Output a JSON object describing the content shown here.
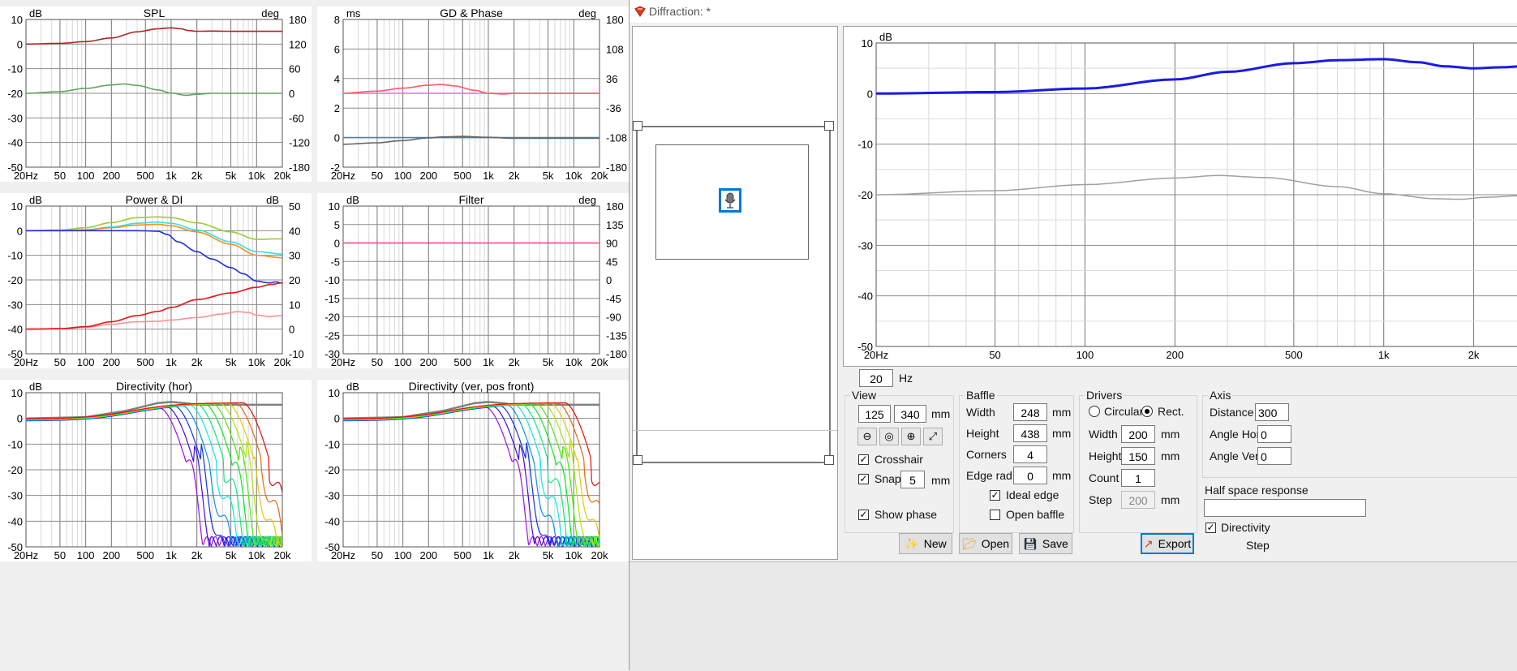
{
  "window": {
    "title": "Diffraction: *",
    "accent": "#0078d7"
  },
  "left_charts": [
    {
      "name": "spl",
      "title": "SPL",
      "left_unit": "dB",
      "right_unit": "deg",
      "y_ticks": [
        "10",
        "0",
        "-10",
        "-20",
        "-30",
        "-40",
        "-50"
      ],
      "r_ticks": [
        "180",
        "120",
        "60",
        "0",
        "-60",
        "-120",
        "-180"
      ],
      "x_ticks": [
        "20Hz",
        "50",
        "100",
        "200",
        "500",
        "1k",
        "2k",
        "5k",
        "10k",
        "20k"
      ],
      "chart_data": {
        "type": "line",
        "x_log": true,
        "xlim": [
          20,
          20000
        ],
        "ylim": [
          -50,
          10
        ],
        "grid": true,
        "series": [
          {
            "color": "#b22222",
            "x": [
              20,
              50,
              100,
              200,
              400,
              700,
              1000,
              1300,
              1600,
              2000,
              3000,
              5000,
              10000,
              20000
            ],
            "y": [
              0,
              0.3,
              1,
              2.5,
              5,
              6.2,
              6.6,
              6.2,
              5.5,
              5.2,
              5.3,
              5.2,
              5.2,
              5.2
            ]
          },
          {
            "color": "#5fa55f",
            "x": [
              20,
              50,
              100,
              200,
              280,
              400,
              700,
              1000,
              1500,
              2000,
              3000,
              5000,
              10000,
              20000
            ],
            "y": [
              -20,
              -19.3,
              -18,
              -16.6,
              -16.2,
              -16.8,
              -18.6,
              -19.9,
              -20.8,
              -20.4,
              -20,
              -20,
              -20,
              -20
            ]
          }
        ]
      }
    },
    {
      "name": "gd-phase",
      "title": "GD & Phase",
      "left_unit": "ms",
      "right_unit": "deg",
      "y_ticks": [
        "8",
        "6",
        "4",
        "2",
        "0",
        "-2"
      ],
      "r_ticks": [
        "180",
        "108",
        "36",
        "-36",
        "-108",
        "-180"
      ],
      "x_ticks": [
        "20Hz",
        "50",
        "100",
        "200",
        "500",
        "1k",
        "2k",
        "5k",
        "10k",
        "20k"
      ],
      "chart_data": {
        "type": "line",
        "x_log": true,
        "xlim": [
          20,
          20000
        ],
        "ylim": [
          -2,
          8
        ],
        "grid": true,
        "series": [
          {
            "color": "#ee66ee",
            "x": [
              20,
              20000
            ],
            "y": [
              3,
              3
            ]
          },
          {
            "color": "#ff5a5a",
            "x": [
              20,
              50,
              100,
              200,
              280,
              400,
              700,
              1000,
              1500,
              2000,
              5000,
              20000
            ],
            "y": [
              3,
              3.15,
              3.35,
              3.55,
              3.6,
              3.5,
              3.2,
              3.0,
              2.95,
              3,
              3,
              3
            ]
          },
          {
            "color": "#4682b4",
            "x": [
              20,
              20000
            ],
            "y": [
              0,
              0
            ]
          },
          {
            "color": "#666666",
            "x": [
              20,
              50,
              100,
              200,
              300,
              500,
              1000,
              2000,
              20000
            ],
            "y": [
              -0.45,
              -0.35,
              -0.2,
              -0.02,
              0.05,
              0.08,
              0.02,
              -0.05,
              -0.05
            ]
          }
        ]
      }
    },
    {
      "name": "power-di",
      "title": "Power & DI",
      "left_unit": "dB",
      "right_unit": "dB",
      "y_ticks": [
        "10",
        "0",
        "-10",
        "-20",
        "-30",
        "-40",
        "-50"
      ],
      "r_ticks": [
        "50",
        "40",
        "30",
        "20",
        "10",
        "0",
        "-10"
      ],
      "x_ticks": [
        "20Hz",
        "50",
        "100",
        "200",
        "500",
        "1k",
        "2k",
        "5k",
        "10k",
        "20k"
      ],
      "chart_data": {
        "type": "line",
        "x_log": true,
        "xlim": [
          20,
          20000
        ],
        "ylim": [
          -50,
          10
        ],
        "grid": true,
        "series": [
          {
            "color": "#9acd32",
            "x": [
              20,
              50,
              100,
              200,
              400,
              700,
              1000,
              2000,
              5000,
              10000,
              20000
            ],
            "y": [
              0,
              0.3,
              1.2,
              3.3,
              5.3,
              5.6,
              5.3,
              3.2,
              -0.5,
              -3.5,
              -3.3
            ]
          },
          {
            "color": "#33e0e8",
            "x": [
              20,
              50,
              100,
              200,
              400,
              700,
              1000,
              2000,
              5000,
              10000,
              20000
            ],
            "y": [
              0,
              0,
              0.4,
              1.5,
              3,
              3.5,
              3,
              0.3,
              -4.5,
              -8.5,
              -9.5
            ]
          },
          {
            "color": "#ff8c1a",
            "x": [
              20,
              50,
              100,
              200,
              400,
              700,
              1000,
              2000,
              5000,
              10000,
              20000
            ],
            "y": [
              0,
              0,
              0.3,
              1.2,
              2.3,
              2.6,
              2,
              -0.5,
              -5.5,
              -10,
              -11
            ]
          },
          {
            "color": "#1e2ee0",
            "x": [
              20,
              50,
              100,
              200,
              400,
              700,
              900,
              1200,
              2000,
              3000,
              5000,
              7000,
              10000,
              14000,
              17000,
              20000
            ],
            "y": [
              0,
              0,
              0,
              0,
              0,
              -0.2,
              -1.5,
              -4.5,
              -8.5,
              -11.5,
              -15,
              -17.5,
              -20.5,
              -21.2,
              -20.8,
              -21.3
            ]
          },
          {
            "color": "#ff9090",
            "x": [
              20,
              50,
              100,
              200,
              400,
              700,
              1000,
              2000,
              4000,
              6000,
              8000,
              10000,
              14000,
              20000
            ],
            "y": [
              -40,
              -39.8,
              -39.2,
              -38,
              -37,
              -36.8,
              -36.3,
              -35.3,
              -33.8,
              -32.9,
              -33.2,
              -34.3,
              -34.8,
              -34.5
            ]
          },
          {
            "color": "#ee1111",
            "x": [
              20,
              50,
              100,
              200,
              400,
              700,
              1000,
              2000,
              5000,
              10000,
              15000,
              20000
            ],
            "y": [
              -40,
              -39.8,
              -39,
              -37,
              -34.5,
              -32.8,
              -31.2,
              -28,
              -25.3,
              -23,
              -21.8,
              -21.2
            ]
          }
        ]
      }
    },
    {
      "name": "filter",
      "title": "Filter",
      "left_unit": "dB",
      "right_unit": "deg",
      "y_ticks": [
        "10",
        "5",
        "0",
        "-5",
        "-10",
        "-15",
        "-20",
        "-25",
        "-30"
      ],
      "r_ticks": [
        "180",
        "135",
        "90",
        "45",
        "0",
        "-45",
        "-90",
        "-135",
        "-180"
      ],
      "x_ticks": [
        "20Hz",
        "50",
        "100",
        "200",
        "500",
        "1k",
        "2k",
        "5k",
        "10k",
        "20k"
      ],
      "chart_data": {
        "type": "line",
        "x_log": true,
        "xlim": [
          20,
          20000
        ],
        "ylim": [
          -30,
          10
        ],
        "grid": true,
        "series": [
          {
            "color": "#ff3b8a",
            "x": [
              20,
              20000
            ],
            "y": [
              0,
              0
            ]
          }
        ]
      }
    },
    {
      "name": "directivity-hor",
      "title": "Directivity (hor)",
      "left_unit": "dB",
      "right_unit": "",
      "y_ticks": [
        "10",
        "0",
        "-10",
        "-20",
        "-30",
        "-40",
        "-50"
      ],
      "r_ticks": [],
      "x_ticks": [
        "20Hz",
        "50",
        "100",
        "200",
        "500",
        "1k",
        "2k",
        "5k",
        "10k",
        "20k"
      ],
      "chart_data": {
        "type": "line",
        "x_log": true,
        "xlim": [
          20,
          20000
        ],
        "ylim": [
          -50,
          10
        ],
        "grid": true,
        "family": "polar-fan",
        "fc_start": 1500,
        "fc_end": 14000,
        "count": 12
      }
    },
    {
      "name": "directivity-ver",
      "title": "Directivity (ver, pos front)",
      "left_unit": "dB",
      "right_unit": "",
      "y_ticks": [
        "10",
        "0",
        "-10",
        "-20",
        "-30",
        "-40",
        "-50"
      ],
      "r_ticks": [],
      "x_ticks": [
        "20Hz",
        "50",
        "100",
        "200",
        "500",
        "1k",
        "2k",
        "5k",
        "10k",
        "20k"
      ],
      "chart_data": {
        "type": "line",
        "x_log": true,
        "xlim": [
          20,
          20000
        ],
        "ylim": [
          -50,
          10
        ],
        "grid": true,
        "family": "polar-fan",
        "fc_start": 1900,
        "fc_end": 16000,
        "count": 12
      }
    }
  ],
  "main_chart": {
    "left_unit": "dB",
    "y_ticks": [
      "10",
      "0",
      "-10",
      "-20",
      "-30",
      "-40",
      "-50"
    ],
    "x_ticks": [
      "20Hz",
      "50",
      "100",
      "200",
      "500",
      "1k",
      "2k"
    ],
    "chart_data": {
      "type": "line",
      "x_log": true,
      "xlim": [
        20,
        2900
      ],
      "ylim": [
        -50,
        10
      ],
      "grid": true,
      "series": [
        {
          "color": "#1a1ae6",
          "width": 3,
          "x": [
            20,
            50,
            100,
            200,
            300,
            500,
            700,
            1000,
            1300,
            1600,
            2000,
            2500,
            2900
          ],
          "y": [
            0,
            0.3,
            1,
            2.8,
            4.3,
            6,
            6.6,
            6.8,
            6.2,
            5.4,
            5.0,
            5.2,
            5.4
          ]
        },
        {
          "color": "#a0a0a0",
          "width": 1.5,
          "x": [
            20,
            50,
            100,
            200,
            280,
            400,
            700,
            1000,
            1500,
            1800,
            2200,
            2900
          ],
          "y": [
            -20,
            -19.2,
            -18,
            -16.7,
            -16.2,
            -16.6,
            -18.4,
            -19.8,
            -20.8,
            -20.9,
            -20.5,
            -20.2
          ]
        }
      ]
    }
  },
  "freq": {
    "value": "20",
    "unit": "Hz"
  },
  "view": {
    "title": "View",
    "w": "125",
    "h": "340",
    "unit": "mm",
    "crosshair": "Crosshair",
    "snap": "Snap",
    "snap_value": "5",
    "snap_unit": "mm",
    "show_phase": "Show phase"
  },
  "baffle": {
    "title": "Baffle",
    "width_label": "Width",
    "width": "248",
    "height_label": "Height",
    "height": "438",
    "corners_label": "Corners",
    "corners": "4",
    "edge_label": "Edge rad.",
    "edge": "0",
    "unit": "mm",
    "ideal_edge": "Ideal edge",
    "open_baffle": "Open baffle"
  },
  "drivers": {
    "title": "Drivers",
    "circular": "Circular",
    "rect": "Rect.",
    "width_label": "Width",
    "width": "200",
    "height_label": "Height",
    "height": "150",
    "count_label": "Count",
    "count": "1",
    "step_label": "Step",
    "step": "200",
    "unit": "mm"
  },
  "axis": {
    "title": "Axis",
    "distance_label": "Distance",
    "distance": "300",
    "angle_hor_label": "Angle Hor",
    "angle_hor": "0",
    "angle_ver_label": "Angle Ver",
    "angle_ver": "0",
    "half_space": "Half space response",
    "directivity": "Directivity",
    "step_label": "Step"
  },
  "buttons": {
    "new": "New",
    "open": "Open",
    "save": "Save",
    "export": "Export"
  }
}
